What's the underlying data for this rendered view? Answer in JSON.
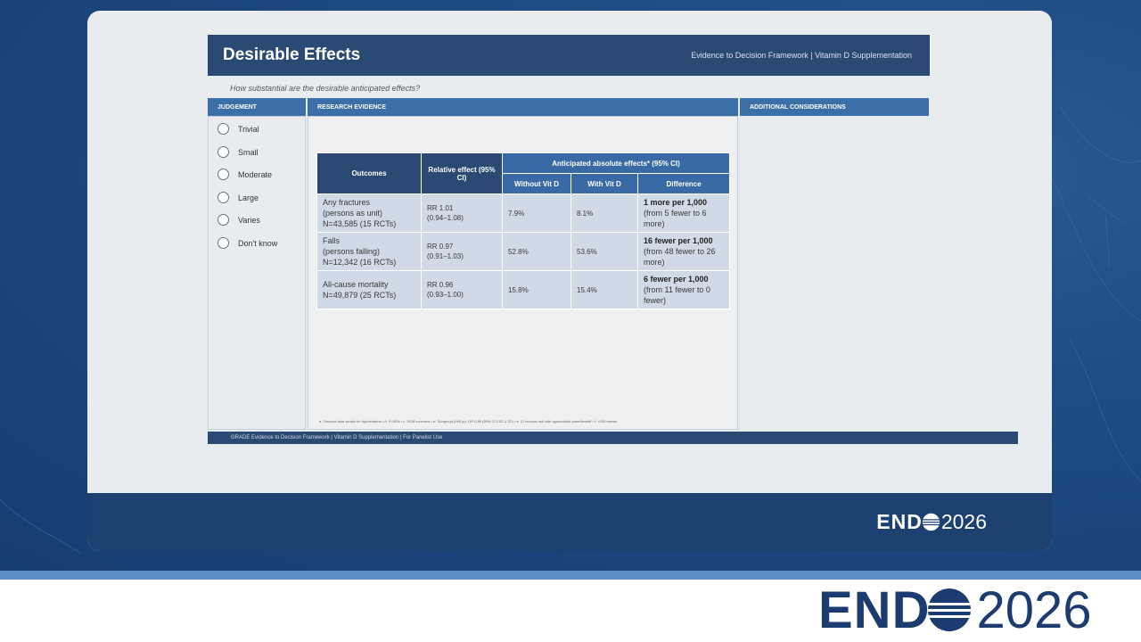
{
  "slide": {
    "title": "Desirable Effects",
    "header_right": "Evidence to Decision Framework  |  Vitamin D Supplementation",
    "question": "How substantial are the desirable anticipated effects?",
    "columns": {
      "judgement": "JUDGEMENT",
      "research": "RESEARCH EVIDENCE",
      "additional": "ADDITIONAL CONSIDERATIONS"
    },
    "options": [
      "Trivial",
      "Small",
      "Moderate",
      "Large",
      "Varies",
      "Don't know"
    ],
    "table": {
      "headers": {
        "outcomes": "Outcomes",
        "relative": "Relative effect (95% CI)",
        "anticipated": "Anticipated absolute effects* (95% CI)",
        "without": "Without Vit D",
        "with": "With Vit D",
        "difference": "Difference"
      },
      "rows": [
        {
          "outcome_l1": "Any fractures",
          "outcome_l2": "(persons as unit)",
          "outcome_l3": "N=43,585 (15 RCTs)",
          "rr": "RR 1.01",
          "ci": "(0.94–1.08)",
          "without": "7.9%",
          "with": "8.1%",
          "diff_main": "1 more per 1,000",
          "diff_sub": "(from 5 fewer to 6 more)"
        },
        {
          "outcome_l1": "Falls",
          "outcome_l2": "(persons falling)",
          "outcome_l3": "N=12,342 (16 RCTs)",
          "rr": "RR 0.97",
          "ci": "(0.91–1.03)",
          "without": "52.8%",
          "with": "53.6%",
          "diff_main": "16 fewer  per 1,000",
          "diff_sub": "(from 48 fewer to 26 more)"
        },
        {
          "outcome_l1": "All-cause mortality",
          "outcome_l2": "N=49,879 (25 RCTs)",
          "outcome_l3": "",
          "rr": "RR 0.96",
          "ci": "(0.93–1.00)",
          "without": "15.8%",
          "with": "15.4%",
          "diff_main": "6 fewer per 1,000",
          "diff_sub": "(from 11 fewer to 0 fewer)"
        }
      ]
    },
    "footnote": "a. Fracture data similar for hip/vertebral  •  b. I²<50%  •  c. ROB concerns  •  d. Subgroup (≥65 yr): OR 0.88 (95% CI 0.52–1.32)  •  e. CI crosses null with appreciable harm/benefit  •  f. <100 events",
    "bottom_bar": "GRADE Evidence to Decision Framework  |  Vitamin D Supplementation  |  For Panelist Use"
  },
  "logo": {
    "end": "END",
    "year": "2026"
  },
  "colors": {
    "header": "#2b4a73",
    "column_head": "#3c6ea8",
    "table_cell": "#cfdae6",
    "brand_dark": "#1c3c70"
  }
}
